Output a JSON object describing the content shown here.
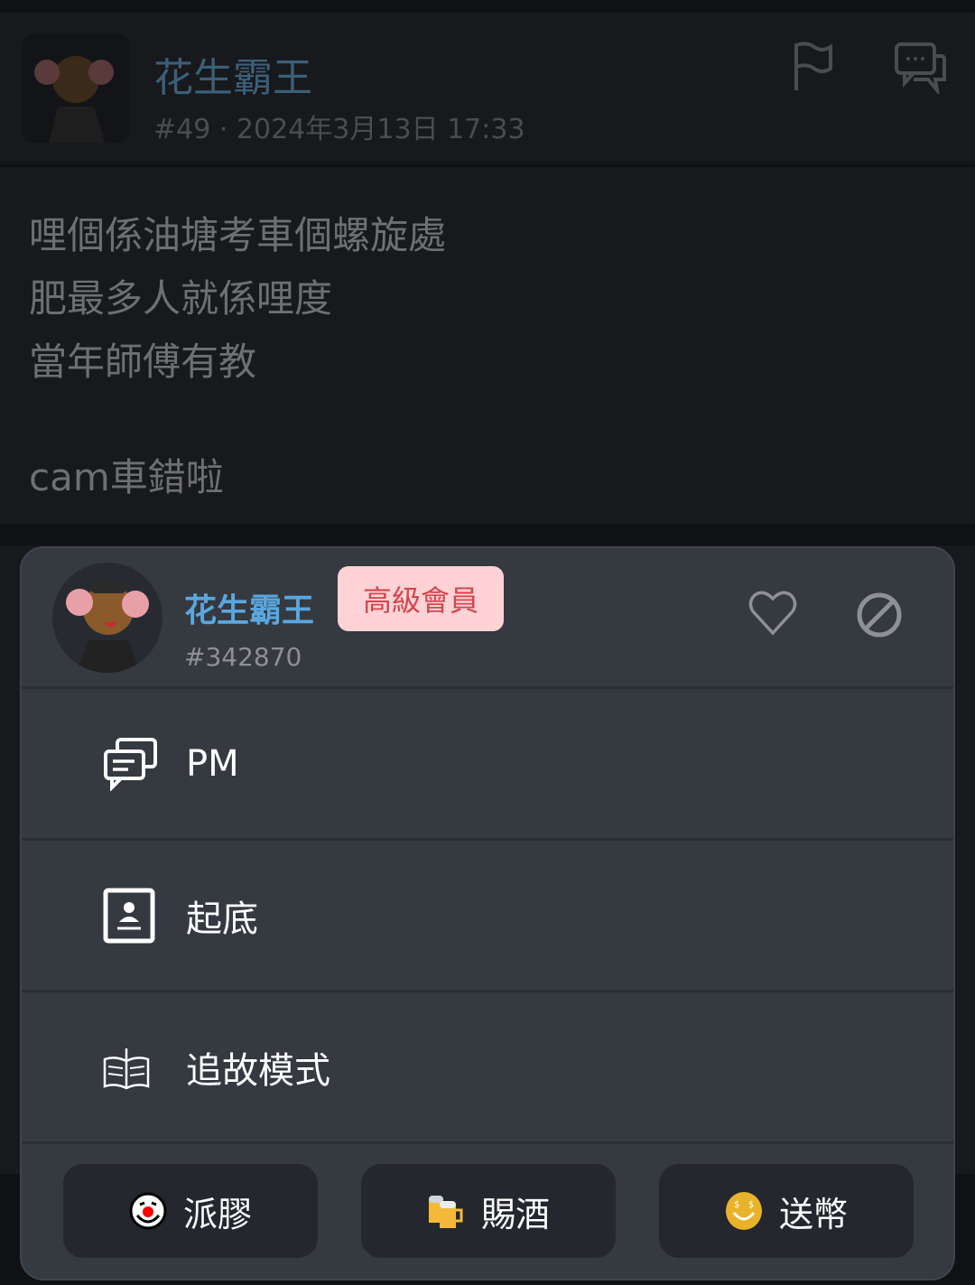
{
  "post": {
    "author": "花生霸王",
    "number": "#49",
    "timestamp": "· 2024年3月13日 17:33",
    "body_lines": [
      "哩個係油塘考車個螺旋處",
      "肥最多人就係哩度",
      "當年師傅有教",
      "",
      "cam車錯啦"
    ],
    "icons": [
      "flag-icon",
      "comment-icon"
    ]
  },
  "profile_sheet": {
    "username": "花生霸王",
    "badge": "高級會員",
    "user_id": "#342870",
    "icons": [
      "heart-icon",
      "block-icon"
    ],
    "menu": [
      {
        "label": "PM",
        "icon": "chat-icon"
      },
      {
        "label": "起底",
        "icon": "profile-card-icon"
      },
      {
        "label": "追故模式",
        "icon": "book-icon"
      }
    ],
    "actions": [
      {
        "label": "派膠",
        "icon": "clown-face-icon"
      },
      {
        "label": "賜酒",
        "icon": "beer-icon"
      },
      {
        "label": "送幣",
        "icon": "coin-smile-icon"
      }
    ],
    "colors": {
      "username": "#5aa7de",
      "badge_bg": "#ffd3d5",
      "badge_text": "#d4454d",
      "sheet_bg": "#353940"
    }
  }
}
